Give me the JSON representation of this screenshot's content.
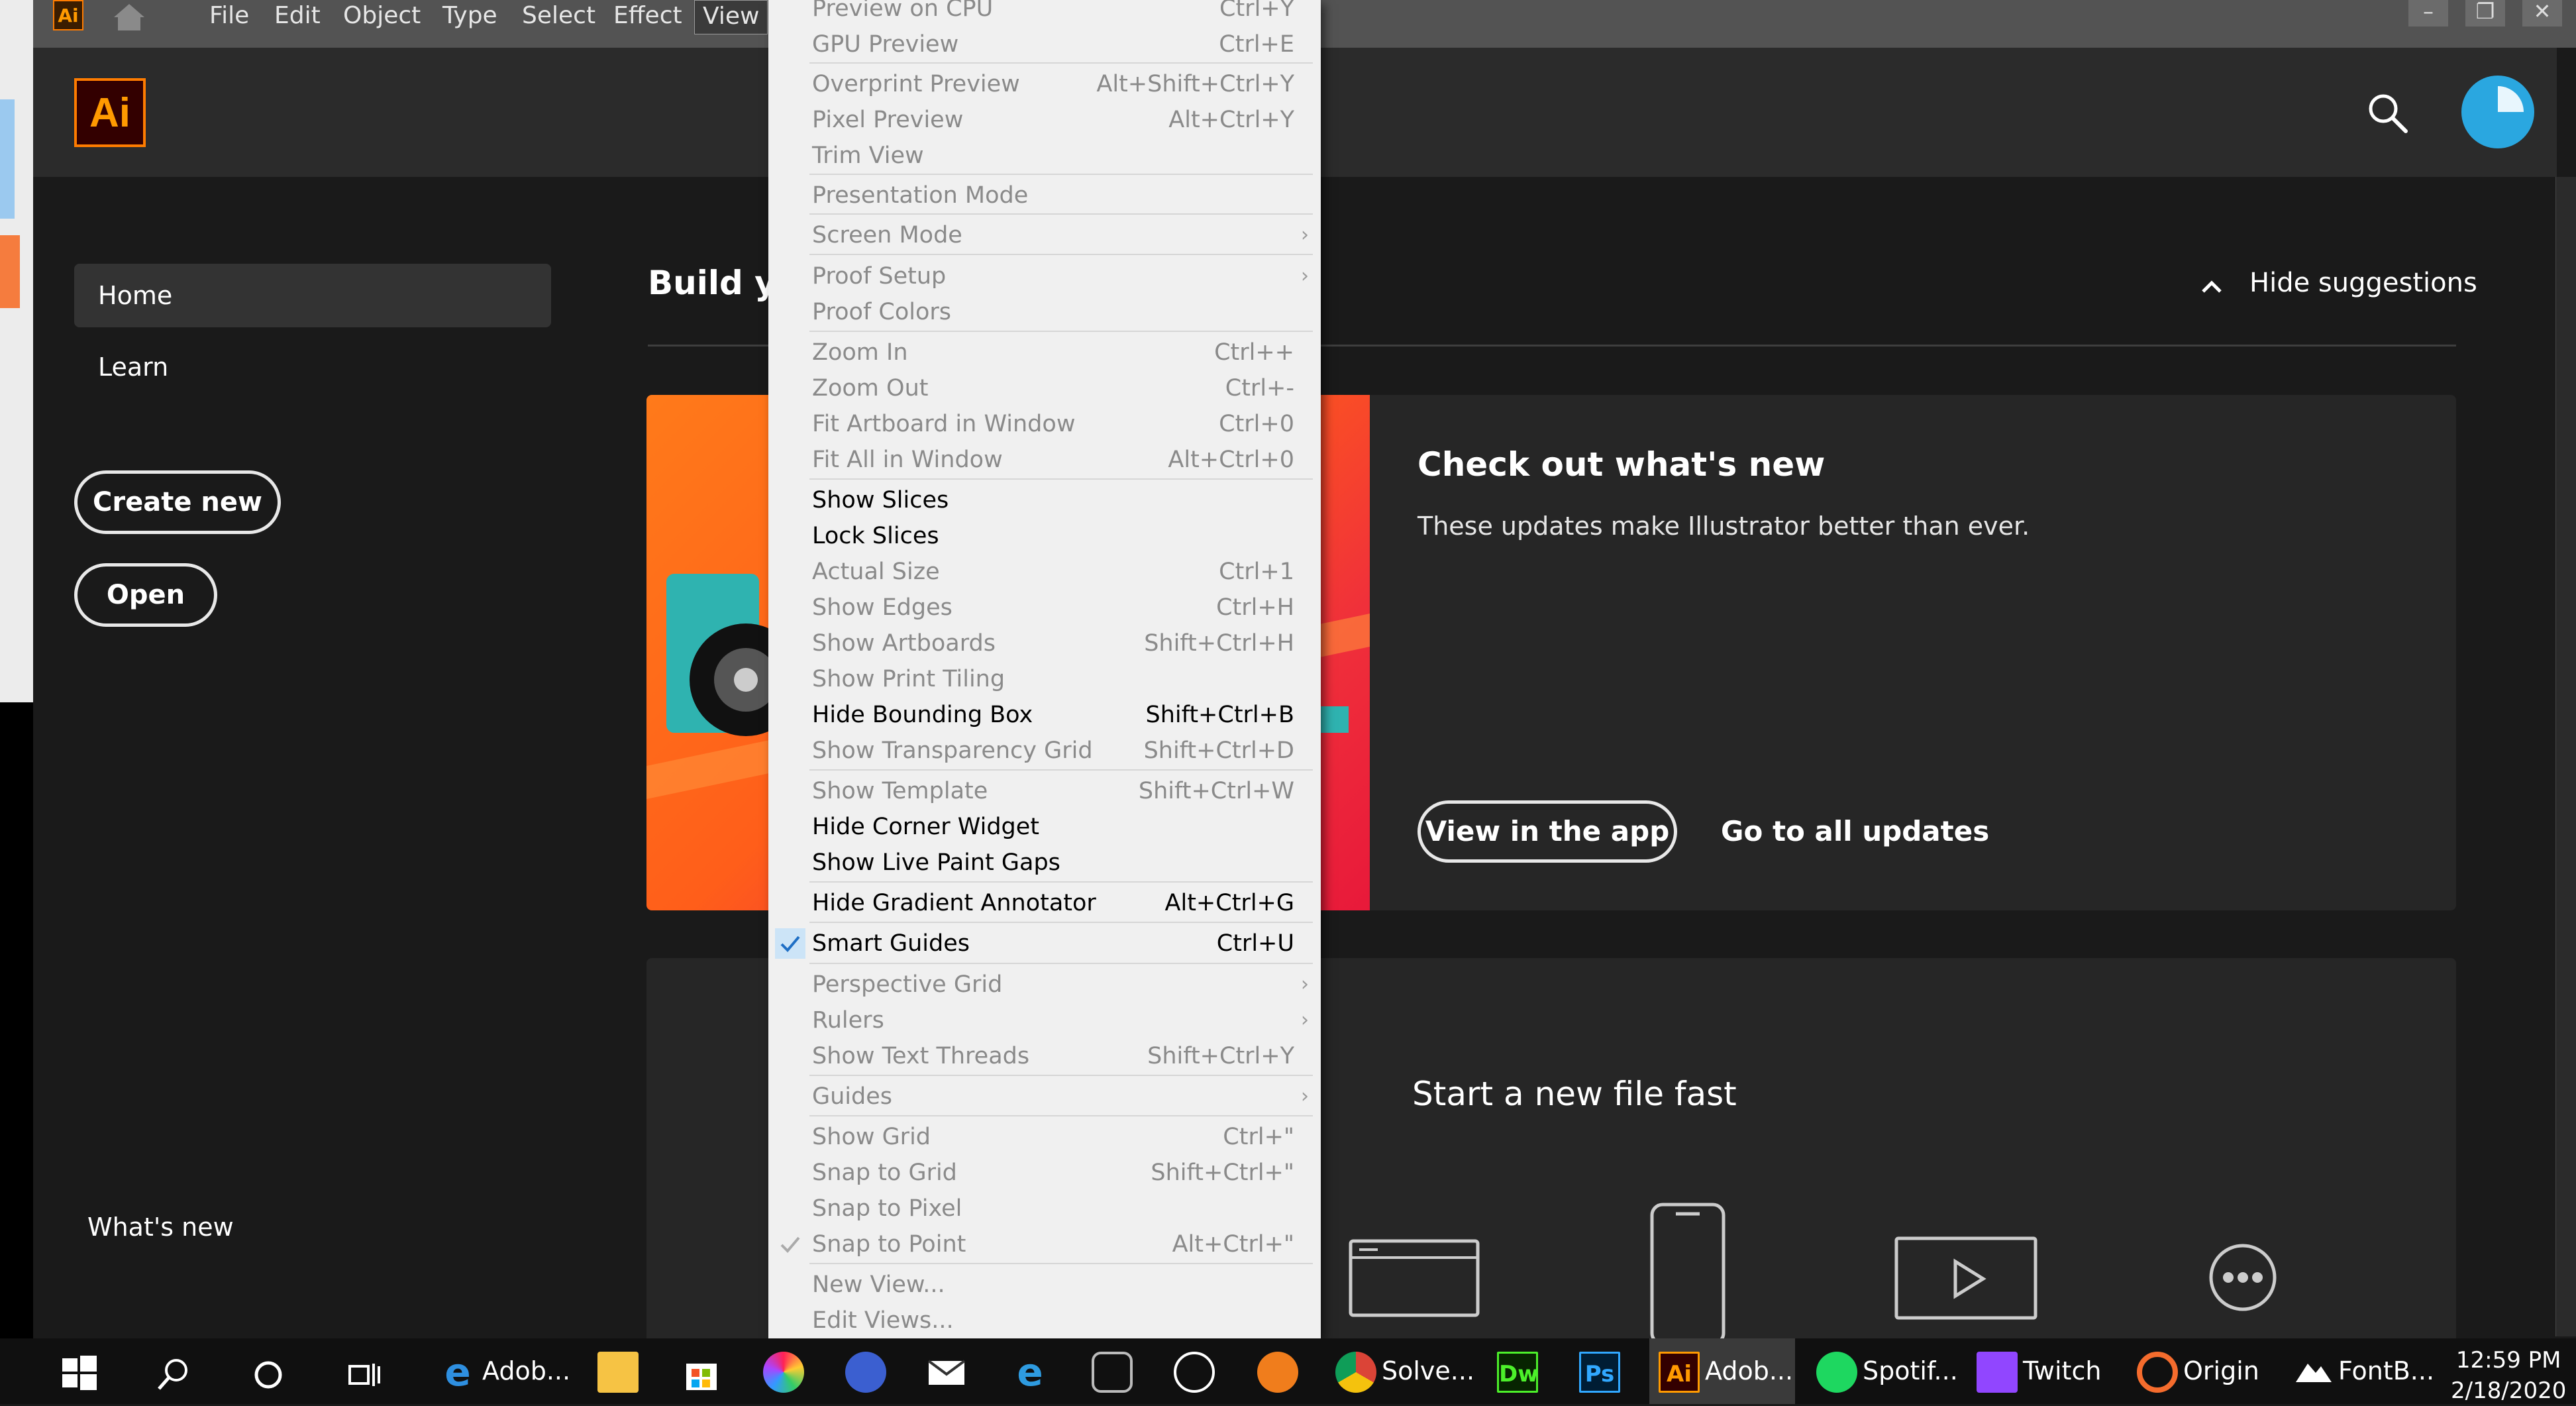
{
  "menubar": {
    "items": [
      "File",
      "Edit",
      "Object",
      "Type",
      "Select",
      "Effect",
      "View"
    ],
    "active": "View",
    "app_badge": "Ai",
    "window_controls": [
      "–",
      "❐",
      "✕"
    ]
  },
  "header": {
    "logo": "Ai"
  },
  "sidebar": {
    "home": "Home",
    "learn": "Learn",
    "create_new": "Create new",
    "open": "Open",
    "whats_new": "What's new"
  },
  "main": {
    "build_title": "Build yo",
    "hide_suggestions": "Hide suggestions",
    "card1": {
      "title": "Check out what's new",
      "subtitle": "These updates make Illustrator better than ever.",
      "view_in_app": "View in the app",
      "go_to_updates": "Go to all updates"
    },
    "card2": {
      "title": "Start a new file fast"
    }
  },
  "view_menu": {
    "items": [
      {
        "label": "Preview on CPU",
        "shortcut": "Ctrl+Y",
        "enabled": false
      },
      {
        "label": "GPU Preview",
        "shortcut": "Ctrl+E",
        "enabled": false
      },
      {
        "label": "Overprint Preview",
        "shortcut": "Alt+Shift+Ctrl+Y",
        "enabled": false
      },
      {
        "label": "Pixel Preview",
        "shortcut": "Alt+Ctrl+Y",
        "enabled": false
      },
      {
        "label": "Trim View",
        "shortcut": "",
        "enabled": false
      },
      {
        "label": "Presentation Mode",
        "shortcut": "",
        "enabled": false
      },
      {
        "label": "Screen Mode",
        "shortcut": "",
        "enabled": false,
        "submenu": true
      },
      {
        "label": "Proof Setup",
        "shortcut": "",
        "enabled": false,
        "submenu": true
      },
      {
        "label": "Proof Colors",
        "shortcut": "",
        "enabled": false
      },
      {
        "label": "Zoom In",
        "shortcut": "Ctrl++",
        "enabled": false
      },
      {
        "label": "Zoom Out",
        "shortcut": "Ctrl+-",
        "enabled": false
      },
      {
        "label": "Fit Artboard in Window",
        "shortcut": "Ctrl+0",
        "enabled": false
      },
      {
        "label": "Fit All in Window",
        "shortcut": "Alt+Ctrl+0",
        "enabled": false
      },
      {
        "label": "Show Slices",
        "shortcut": "",
        "enabled": true
      },
      {
        "label": "Lock Slices",
        "shortcut": "",
        "enabled": true
      },
      {
        "label": "Actual Size",
        "shortcut": "Ctrl+1",
        "enabled": false
      },
      {
        "label": "Show Edges",
        "shortcut": "Ctrl+H",
        "enabled": false
      },
      {
        "label": "Show Artboards",
        "shortcut": "Shift+Ctrl+H",
        "enabled": false
      },
      {
        "label": "Show Print Tiling",
        "shortcut": "",
        "enabled": false
      },
      {
        "label": "Hide Bounding Box",
        "shortcut": "Shift+Ctrl+B",
        "enabled": true
      },
      {
        "label": "Show Transparency Grid",
        "shortcut": "Shift+Ctrl+D",
        "enabled": false
      },
      {
        "label": "Show Template",
        "shortcut": "Shift+Ctrl+W",
        "enabled": false
      },
      {
        "label": "Hide Corner Widget",
        "shortcut": "",
        "enabled": true
      },
      {
        "label": "Show Live Paint Gaps",
        "shortcut": "",
        "enabled": true
      },
      {
        "label": "Hide Gradient Annotator",
        "shortcut": "Alt+Ctrl+G",
        "enabled": true
      },
      {
        "label": "Smart Guides",
        "shortcut": "Ctrl+U",
        "enabled": true,
        "checked": true
      },
      {
        "label": "Perspective Grid",
        "shortcut": "",
        "enabled": false,
        "submenu": true
      },
      {
        "label": "Rulers",
        "shortcut": "",
        "enabled": false,
        "submenu": true
      },
      {
        "label": "Show Text Threads",
        "shortcut": "Shift+Ctrl+Y",
        "enabled": false
      },
      {
        "label": "Guides",
        "shortcut": "",
        "enabled": false,
        "submenu": true
      },
      {
        "label": "Show Grid",
        "shortcut": "Ctrl+\"",
        "enabled": false
      },
      {
        "label": "Snap to Grid",
        "shortcut": "Shift+Ctrl+\"",
        "enabled": false
      },
      {
        "label": "Snap to Pixel",
        "shortcut": "",
        "enabled": false
      },
      {
        "label": "Snap to Point",
        "shortcut": "Alt+Ctrl+\"",
        "enabled": false,
        "checked": true
      },
      {
        "label": "New View...",
        "shortcut": "",
        "enabled": false
      },
      {
        "label": "Edit Views...",
        "shortcut": "",
        "enabled": false
      }
    ]
  },
  "taskbar": {
    "apps": [
      {
        "name": "Edge",
        "label": "Adob..."
      },
      {
        "name": "Chrome",
        "label": "Solve..."
      },
      {
        "name": "Dreamweaver",
        "badge": "Dw"
      },
      {
        "name": "Photoshop",
        "badge": "Ps"
      },
      {
        "name": "Illustrator",
        "badge": "Ai",
        "label": "Adob..."
      },
      {
        "name": "Spotify",
        "label": "Spotif..."
      },
      {
        "name": "Twitch",
        "label": "Twitch"
      },
      {
        "name": "Origin",
        "label": "Origin"
      },
      {
        "name": "FontBase",
        "label": "FontB..."
      }
    ],
    "time": "12:59 PM",
    "date": "2/18/2020"
  },
  "colors": {
    "accent": "#ff7c00",
    "avatar": "#2aa7e0",
    "menu_check": "#1f6fc5"
  }
}
